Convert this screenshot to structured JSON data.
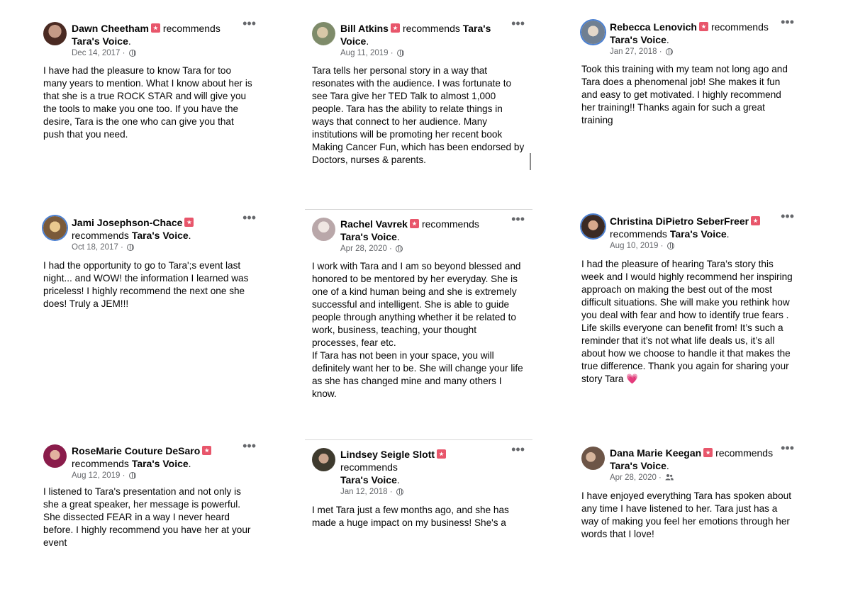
{
  "badge_icon": "recommend-star-icon",
  "reviews": [
    {
      "name": "Dawn Cheetham",
      "recommends": "recommends",
      "page": "Tara's Voice",
      "date": "Dec 14, 2017",
      "privacy_icon": "globe-icon",
      "text": "I have had the pleasure to know Tara for too many years to mention. What I know about her is that she is a true ROCK STAR and will give you the tools to make you one too. If you have the desire, Tara is the one who can give you that push that you need."
    },
    {
      "name": "Bill Atkins",
      "recommends": "recommends",
      "page": "Tara's Voice",
      "date": "Aug 11, 2019",
      "privacy_icon": "globe-icon",
      "text": "Tara tells her personal story in a way that resonates with the audience. I was fortunate to see Tara give her TED Talk to almost 1,000 people. Tara has the ability to relate things in ways that connect to her audience. Many institutions will be promoting her recent book Making Cancer Fun, which has been endorsed by Doctors, nurses & parents."
    },
    {
      "name": "Rebecca Lenovich",
      "recommends": "recommends",
      "page": "Tara's Voice",
      "date": "Jan 27, 2018",
      "privacy_icon": "globe-icon",
      "text": "Took this training with my team not long ago and Tara does a phenomenal job! She makes it fun and easy to get motivated. I highly recommend her training!! Thanks again for such a great training"
    },
    {
      "name": "Jami Josephson-Chace",
      "recommends": "recommends",
      "page": "Tara's Voice",
      "date": "Oct 18, 2017",
      "privacy_icon": "globe-icon",
      "text": "I had the opportunity to go to Tara';s event last night... and WOW! the information I learned was priceless! I highly recommend the next one she does! Truly a JEM!!!"
    },
    {
      "name": "Rachel Vavrek",
      "recommends": "recommends",
      "page": "Tara's Voice",
      "date": "Apr 28, 2020",
      "privacy_icon": "globe-icon",
      "text": "I work with Tara and I am so beyond blessed and honored to be mentored by her everyday. She is one of a kind human being and she is extremely successful and intelligent. She is able to guide people through anything whether it be related to work, business, teaching, your thought processes, fear etc.\nIf Tara has not been in your space, you will definitely want her to be. She will change your life as she has changed mine and many others I know."
    },
    {
      "name": "Christina DiPietro SeberFreer",
      "recommends": "recommends",
      "page": "Tara's Voice",
      "date": "Aug 10, 2019",
      "privacy_icon": "globe-icon",
      "text": "I had the pleasure of hearing Tara’s story this week and I would highly recommend her inspiring approach on making the best out of the most difficult situations.  She will make you rethink how you deal with fear and how to identify true fears . Life skills everyone can benefit from!  It’s such a reminder that it’s not what life deals us, it’s all about how we choose to handle it that makes the true difference. Thank you again for sharing your story Tara 💗"
    },
    {
      "name": "RoseMarie Couture DeSaro",
      "recommends": "recommends",
      "page": "Tara's Voice",
      "date": "Aug 12, 2019",
      "privacy_icon": "globe-icon",
      "text": "I listened to Tara's presentation and not only is she a great speaker,  her message is powerful. She dissected FEAR in a way I never heard before. I highly recommend you have her at your event"
    },
    {
      "name": "Lindsey Seigle Slott",
      "recommends": "recommends",
      "page": "Tara's Voice",
      "date": "Jan 12, 2018",
      "privacy_icon": "globe-icon",
      "text": "I met Tara just a few months ago, and she has made a huge impact on my business! She's a"
    },
    {
      "name": "Dana Marie Keegan",
      "recommends": "recommends",
      "page": "Tara's Voice",
      "date": "Apr 28, 2020",
      "privacy_icon": "friends-icon",
      "text": "I have enjoyed everything Tara has spoken about any time I have listened to her. Tara just has a way of making you feel her emotions through her words that I love!"
    }
  ]
}
